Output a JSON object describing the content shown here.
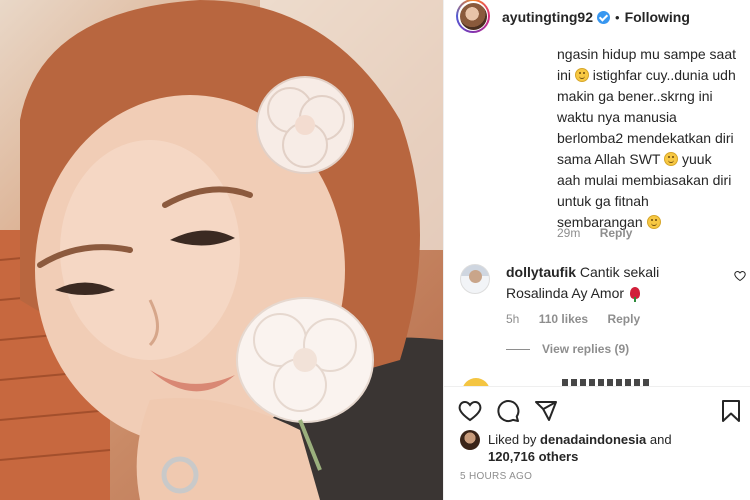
{
  "post": {
    "username": "ayutingting92",
    "follow_label": "Following",
    "separator": "•"
  },
  "comment_reply": {
    "text_parts": [
      "ngasin hidup mu sampe saat ini ",
      " istighfar cuy..dunia udh makin ga bener..skrng ini waktu nya manusia berlomba2 mendekatkan diri sama Allah SWT ",
      " yuuk aah mulai membiasakan diri untuk ga fitnah sembarangan "
    ],
    "emoji": "smiling-face",
    "time": "29m",
    "reply_label": "Reply"
  },
  "comment": {
    "username": "dollytaufik",
    "text": "Cantik sekali Rosalinda Ay Amor",
    "emoji": "rose",
    "time": "5h",
    "likes": "110 likes",
    "reply_label": "Reply",
    "view_replies": "View replies (9)"
  },
  "likes": {
    "liked_by_prefix": "Liked by ",
    "liked_by_user": "denadaindonesia",
    "and": " and",
    "others": "120,716 others"
  },
  "timestamp": "5 HOURS AGO",
  "icons": [
    "heart-icon",
    "comment-icon",
    "share-icon",
    "bookmark-icon",
    "verified-badge-icon"
  ],
  "colors": {
    "accent_blue": "#3897f0",
    "text": "#262626",
    "muted": "#8e8e8e"
  }
}
